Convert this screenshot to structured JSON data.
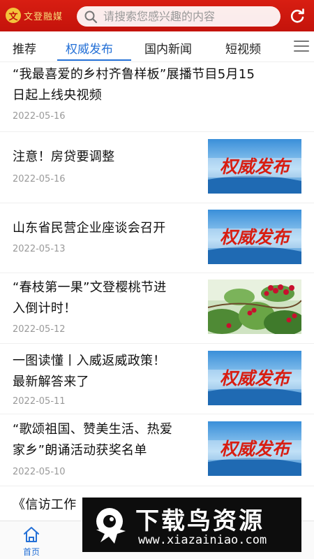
{
  "header": {
    "logo_glyph": "文",
    "logo_text": "文登融媒",
    "search_placeholder": "请搜索您感兴趣的内容",
    "brand_color": "#d81e12"
  },
  "tabs": [
    {
      "label": "推荐",
      "active": false
    },
    {
      "label": "权威发布",
      "active": true
    },
    {
      "label": "国内新闻",
      "active": false
    },
    {
      "label": "短视频",
      "active": false
    }
  ],
  "articles": [
    {
      "title_lines": [
        "“我最喜爱的乡村齐鲁样板”展播节目5月15",
        "日起上线央视频"
      ],
      "date": "2022-05-16",
      "thumb": "none"
    },
    {
      "title_lines": [
        "注意！房贷要调整"
      ],
      "date": "2022-05-16",
      "thumb": "quanwei-banner",
      "thumb_text": "权威发布"
    },
    {
      "title_lines": [
        "山东省民营企业座谈会召开"
      ],
      "date": "2022-05-13",
      "thumb": "quanwei-banner",
      "thumb_text": "权威发布"
    },
    {
      "title_lines": [
        "“春枝第一果”文登樱桃节进",
        "入倒计时！"
      ],
      "date": "2022-05-12",
      "thumb": "cherry-photo"
    },
    {
      "title_lines": [
        "一图读懂丨入威返威政策！",
        "最新解答来了"
      ],
      "date": "2022-05-11",
      "thumb": "quanwei-banner",
      "thumb_text": "权威发布"
    },
    {
      "title_lines": [
        "“歌颂祖国、赞美生活、热爱",
        "家乡”朗诵活动获奖名单"
      ],
      "date": "2022-05-10",
      "thumb": "quanwei-banner",
      "thumb_text": "权威发布"
    },
    {
      "title_lines": [
        "《信访工作"
      ],
      "date": "",
      "thumb": "none"
    }
  ],
  "bottom_nav": [
    {
      "label": "首页",
      "icon": "home-icon",
      "active": true
    }
  ],
  "watermark": {
    "title": "下载鸟资源",
    "url": "www.xiazainiao.com"
  }
}
